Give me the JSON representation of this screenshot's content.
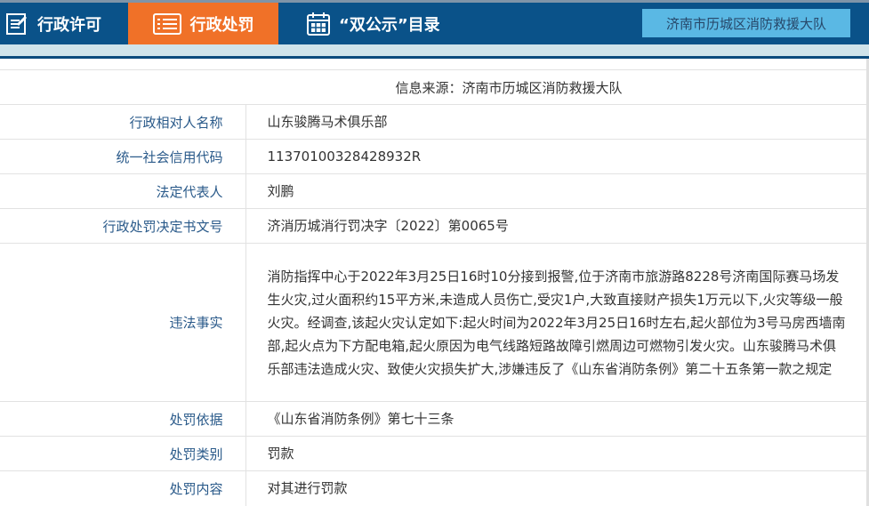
{
  "nav": {
    "tabs": [
      {
        "label": "行政许可",
        "icon": "edit-icon"
      },
      {
        "label": "行政处罚",
        "icon": "list-icon",
        "active": true
      },
      {
        "label": "“双公示”目录",
        "icon": "calendar-icon"
      }
    ],
    "unit": "济南市历城区消防救援大队"
  },
  "colors": {
    "header": "#0a5289",
    "active": "#f07128",
    "unit_bg": "#5ab8e4"
  },
  "source": "信息来源：济南市历城区消防救援大队",
  "rows": [
    {
      "label": "行政相对人名称",
      "value": "山东骏腾马术俱乐部"
    },
    {
      "label": "统一社会信用代码",
      "value": "11370100328428932R"
    },
    {
      "label": "法定代表人",
      "value": "刘鹏"
    },
    {
      "label": "行政处罚决定书文号",
      "value": "济消历城消行罚决字〔2022〕第0065号"
    },
    {
      "label": "违法事实",
      "value": "消防指挥中心于2022年3月25日16时10分接到报警,位于济南市旅游路8228号济南国际赛马场发生火灾,过火面积约15平方米,未造成人员伤亡,受灾1户,大致直接财产损失1万元以下,火灾等级一般火灾。经调查,该起火灾认定如下:起火时间为2022年3月25日16时左右,起火部位为3号马房西墙南部,起火点为下方配电箱,起火原因为电气线路短路故障引燃周边可燃物引发火灾。山东骏腾马术俱乐部违法造成火灾、致使火灾损失扩大,涉嫌违反了《山东省消防条例》第二十五条第一款之规定"
    },
    {
      "label": "处罚依据",
      "value": "《山东省消防条例》第七十三条"
    },
    {
      "label": "处罚类别",
      "value": "罚款"
    },
    {
      "label": "处罚内容",
      "value": "对其进行罚款"
    }
  ]
}
